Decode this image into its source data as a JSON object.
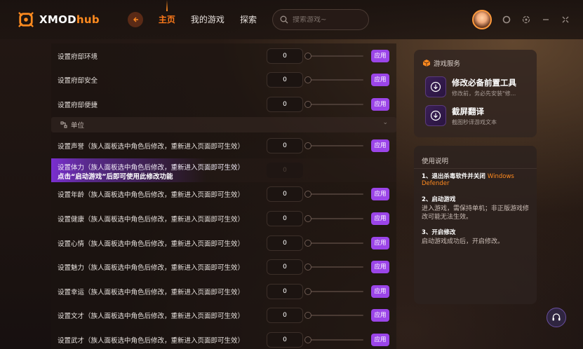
{
  "app": {
    "logo_prefix": "XMOD",
    "logo_suffix": "hub"
  },
  "nav": {
    "items": [
      {
        "label": "主页",
        "active": true
      },
      {
        "label": "我的游戏",
        "active": false
      },
      {
        "label": "探索",
        "active": false
      }
    ]
  },
  "search": {
    "placeholder": "搜索游戏~"
  },
  "rows_top": [
    {
      "label": "设置府邸环境",
      "value": "0",
      "apply": "应用"
    },
    {
      "label": "设置府邸安全",
      "value": "0",
      "apply": "应用"
    },
    {
      "label": "设置府邸便捷",
      "value": "0",
      "apply": "应用"
    }
  ],
  "section": {
    "label": "单位"
  },
  "rows_unit": [
    {
      "label": "设置声誉（族人面板选中角色后修改，重新进入页面即可生效）",
      "value": "0",
      "apply": "应用"
    },
    {
      "label": "设置年龄（族人面板选中角色后修改，重新进入页面即可生效）",
      "value": "0",
      "apply": "应用"
    },
    {
      "label": "设置健康（族人面板选中角色后修改，重新进入页面即可生效）",
      "value": "0",
      "apply": "应用"
    },
    {
      "label": "设置心情（族人面板选中角色后修改，重新进入页面即可生效）",
      "value": "0",
      "apply": "应用"
    },
    {
      "label": "设置魅力（族人面板选中角色后修改，重新进入页面即可生效）",
      "value": "0",
      "apply": "应用"
    },
    {
      "label": "设置幸运（族人面板选中角色后修改，重新进入页面即可生效）",
      "value": "0",
      "apply": "应用"
    },
    {
      "label": "设置文才（族人面板选中角色后修改，重新进入页面即可生效）",
      "value": "0",
      "apply": "应用"
    },
    {
      "label": "设置武才（族人面板选中角色后修改，重新进入页面即可生效）",
      "value": "0",
      "apply": "应用"
    }
  ],
  "tooltip_row": {
    "label": "设置体力（族人面板选中角色后修改，重新进入页面即可生效）",
    "notice": "点击“启动游戏”后即可使用此修改功能",
    "value": "0"
  },
  "services": {
    "title": "游戏服务",
    "items": [
      {
        "title": "修改必备前置工具",
        "subtitle": "修改前，务必先安装\"修..."
      },
      {
        "title": "截屏翻译",
        "subtitle": "截图秒译游戏文本"
      }
    ]
  },
  "help": {
    "title": "使用说明",
    "steps": [
      {
        "title": "1、退出杀毒软件并关闭",
        "highlight": "Windows Defender",
        "body": ""
      },
      {
        "title": "2、启动游戏",
        "highlight": "",
        "body": "进入游戏，需保持单机；非正版游戏修改可能无法生效。"
      },
      {
        "title": "3、开启修改",
        "highlight": "",
        "body": "启动游戏成功后，开启修改。"
      }
    ]
  },
  "colors": {
    "accent_orange": "#ff7a1a",
    "apply_purple": "#9b45e8"
  }
}
